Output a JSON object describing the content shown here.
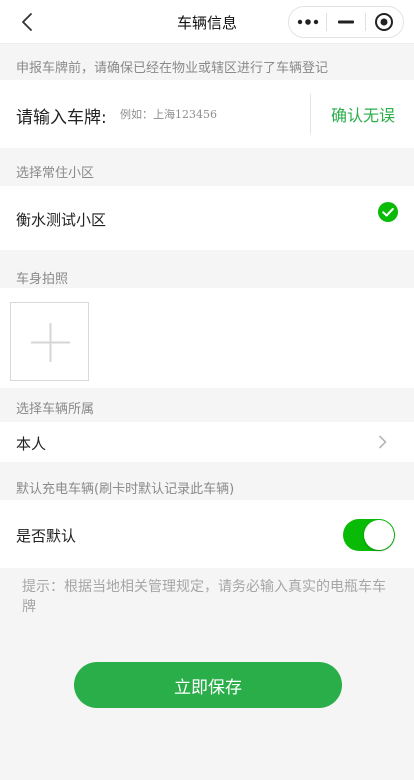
{
  "nav": {
    "title": "车辆信息",
    "back_icon": "chevron-left-icon",
    "capsule_icons": [
      "more-dots-icon",
      "minimize-icon",
      "target-circle-icon"
    ]
  },
  "plate_section": {
    "notice": "申报车牌前，请确保已经在物业或辖区进行了车辆登记",
    "label": "请输入车牌:",
    "placeholder": "例如：上海123456",
    "value": "",
    "confirm_label": "确认无误"
  },
  "community_section": {
    "header": "选择常住小区",
    "selected": "衡水测试小区",
    "selected_icon": "check-circle-icon"
  },
  "photo_section": {
    "header": "车身拍照",
    "add_icon": "plus-icon"
  },
  "owner_section": {
    "header": "选择车辆所属",
    "selected": "本人",
    "chevron_icon": "chevron-right-icon"
  },
  "default_section": {
    "header": "默认充电车辆(刷卡时默认记录此车辆)",
    "label": "是否默认",
    "enabled": true
  },
  "tip": "提示：根据当地相关管理规定，请务必输入真实的电瓶车车牌",
  "save_label": "立即保存",
  "colors": {
    "accent_green": "#2aae49",
    "switch_green": "#09bb07",
    "muted_text": "#8a8a8a",
    "page_bg": "#f5f5f5"
  }
}
